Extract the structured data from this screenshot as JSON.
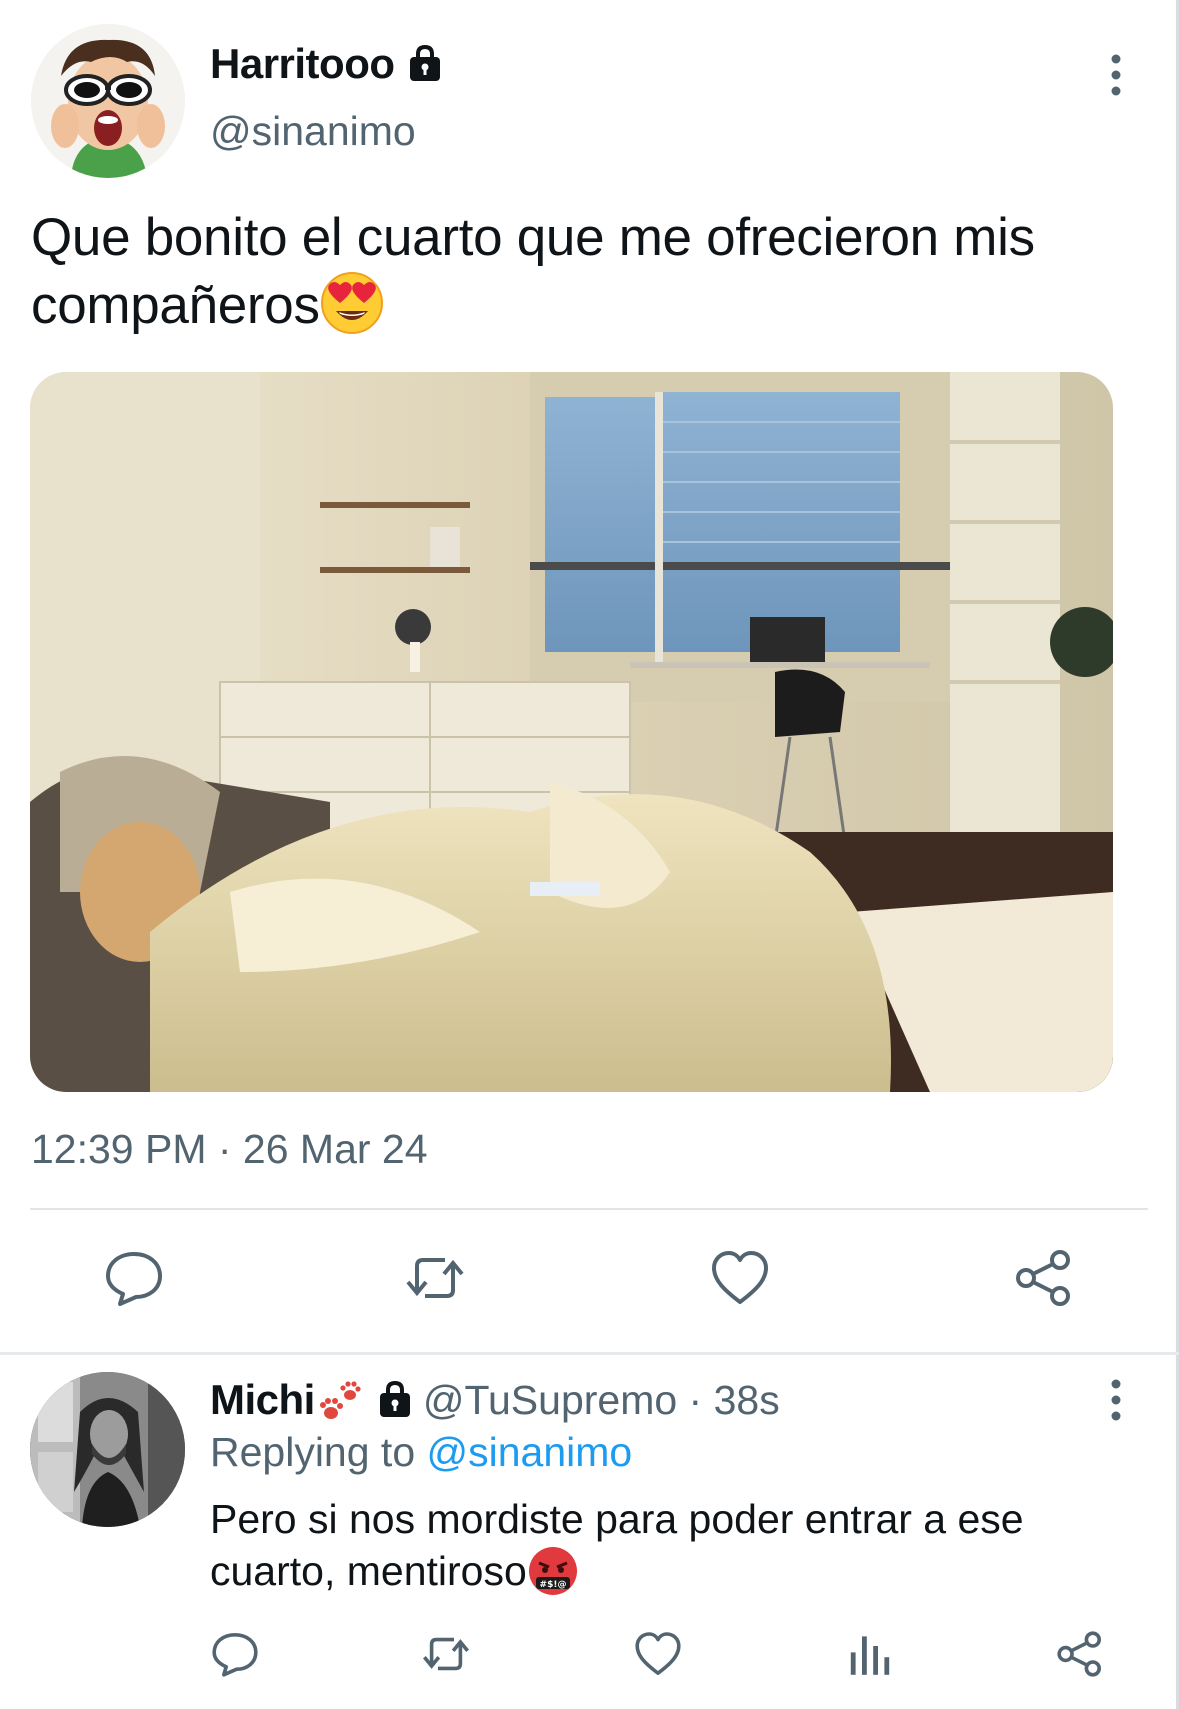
{
  "tweet": {
    "display_name": "Harritooo",
    "handle": "@sinanimo",
    "text": "Que bonito el cuarto que me ofrecieron mis compañeros",
    "timestamp": "12:39 PM · 26 Mar 24",
    "emoji": "heart-eyes-emoji"
  },
  "reply": {
    "display_name": "Michi",
    "handle_time": "@TuSupremo · 38s",
    "replying_label": "Replying to ",
    "replying_handle": "@sinanimo",
    "text": "Pero si nos mordiste para poder entrar a ese cuarto, mentiroso",
    "emoji": "cursing-face-emoji"
  },
  "icons": {
    "actions_main": [
      "reply-icon",
      "retweet-icon",
      "like-icon",
      "share-icon"
    ],
    "actions_reply": [
      "reply-icon",
      "retweet-icon",
      "like-icon",
      "views-icon",
      "share-icon"
    ]
  },
  "colors": {
    "text": "#0f1419",
    "secondary": "#536471",
    "link": "#1d9bf0"
  }
}
